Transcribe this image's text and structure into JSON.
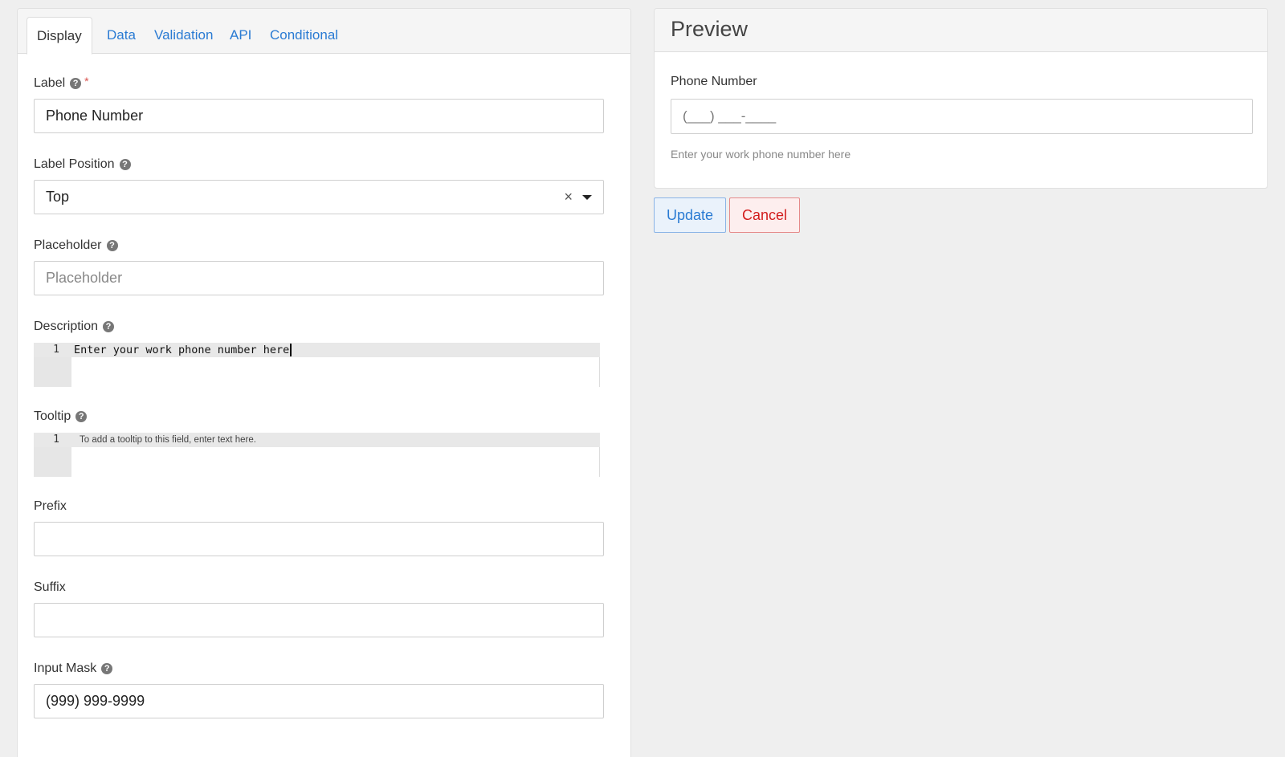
{
  "tabs": [
    {
      "label": "Display",
      "active": true
    },
    {
      "label": "Data",
      "active": false
    },
    {
      "label": "Validation",
      "active": false
    },
    {
      "label": "API",
      "active": false
    },
    {
      "label": "Conditional",
      "active": false
    }
  ],
  "fields": {
    "label": {
      "label": "Label",
      "value": "Phone Number",
      "required": true
    },
    "label_position": {
      "label": "Label Position",
      "value": "Top",
      "clear_glyph": "×"
    },
    "placeholder": {
      "label": "Placeholder",
      "value": "",
      "placeholder": "Placeholder"
    },
    "description": {
      "label": "Description",
      "line_number": "1",
      "value": "Enter your work phone number here"
    },
    "tooltip": {
      "label": "Tooltip",
      "line_number": "1",
      "placeholder": "To add a tooltip to this field, enter text here."
    },
    "prefix": {
      "label": "Prefix",
      "value": ""
    },
    "suffix": {
      "label": "Suffix",
      "value": ""
    },
    "input_mask": {
      "label": "Input Mask",
      "value": "(999) 999-9999"
    }
  },
  "help_glyph": "?",
  "required_glyph": "*",
  "preview": {
    "title": "Preview",
    "field_label": "Phone Number",
    "input_placeholder": "(___) ___-____",
    "description": "Enter your work phone number here"
  },
  "buttons": {
    "update": "Update",
    "cancel": "Cancel"
  },
  "colors": {
    "background": "#efefef",
    "link_blue": "#2a7bd3",
    "danger_red": "#d21c1c",
    "required_red": "#d9534f"
  }
}
